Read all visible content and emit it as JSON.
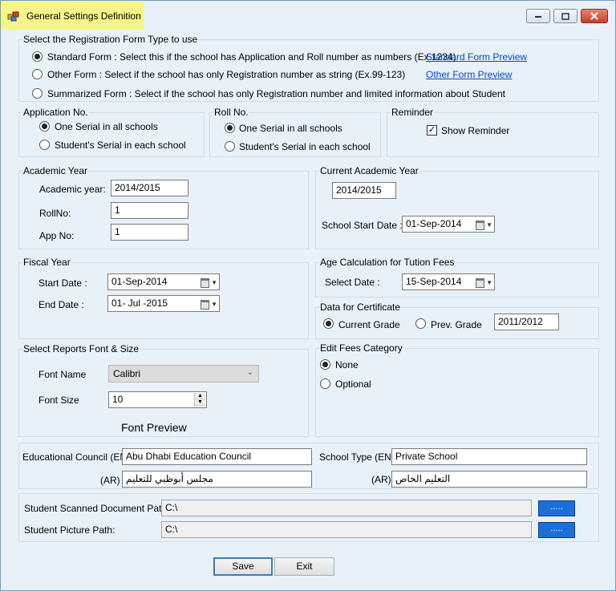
{
  "window": {
    "title": "General Settings Definition"
  },
  "registration_type": {
    "group_title": "Select the Registration Form Type to use",
    "options": [
      {
        "label": "Standard Form : Select this if the school has Application and Roll number as numbers (Ex.1234)",
        "checked": true
      },
      {
        "label": "Other Form : Select if the school has only Registration number as string (Ex.99-123)",
        "checked": false
      },
      {
        "label": "Summarized Form : Select if the school has only Registration number and limited information about Student",
        "checked": false
      }
    ],
    "standard_preview_link": "Standard Form Preview",
    "other_preview_link": "Other Form Preview"
  },
  "application_no": {
    "group_title": "Application No.",
    "options": [
      "One Serial in all schools",
      "Student's Serial in each school"
    ],
    "selected": 0
  },
  "roll_no": {
    "group_title": "Roll No.",
    "options": [
      "One Serial in all schools",
      "Student's Serial in each school"
    ],
    "selected": 0
  },
  "reminder": {
    "group_title": "Reminder",
    "show_label": "Show Reminder",
    "show_checked": true,
    "check_glyph": "✓"
  },
  "academic_year": {
    "group_title": "Academic Year",
    "year_label": "Academic year:",
    "year_value": "2014/2015",
    "rollno_label": "RollNo:",
    "rollno_value": "1",
    "appno_label": "App No:",
    "appno_value": "1"
  },
  "current_academic_year": {
    "group_title": "Current Academic Year",
    "value": "2014/2015",
    "start_label": "School Start Date :",
    "start_value": "01-Sep-2014"
  },
  "fiscal_year": {
    "group_title": "Fiscal Year",
    "start_label": "Start Date :",
    "start_value": "01-Sep-2014",
    "end_label": "End Date :",
    "end_value": "01- Jul -2015"
  },
  "age_calc": {
    "group_title": "Age Calculation for Tution Fees",
    "select_label": "Select Date :",
    "select_value": "15-Sep-2014"
  },
  "certificate": {
    "group_title": "Data for Certificate",
    "current_label": "Current Grade",
    "prev_label": "Prev. Grade",
    "selected": "current",
    "prev_value": "2011/2012"
  },
  "reports_font": {
    "group_title": "Select Reports Font & Size",
    "name_label": "Font Name",
    "name_value": "Calibri",
    "size_label": "Font Size",
    "size_value": "10",
    "preview_label": "Font Preview"
  },
  "fees_category": {
    "group_title": "Edit Fees Category",
    "options": [
      "None",
      "Optional"
    ],
    "selected": 0
  },
  "council": {
    "en_label": "Educational Council  (EN)",
    "en_value": "Abu Dhabi Education Council",
    "ar_label": "(AR)",
    "ar_value": "مجلس أبوظبي للتعليم",
    "school_type_label": "School Type  (EN)",
    "school_type_value": "Private School",
    "school_type_ar_label": "(AR)",
    "school_type_ar_value": "التعليم الخاص"
  },
  "paths": {
    "scanned_label": "Student Scanned Document Path:",
    "scanned_value": "C:\\",
    "picture_label": "Student Picture Path:",
    "picture_value": "C:\\",
    "browse_label": "....."
  },
  "buttons": {
    "save": "Save",
    "exit": "Exit"
  },
  "icons": {
    "minimize": "minimize-icon",
    "maximize": "maximize-icon",
    "close": "close-icon"
  }
}
